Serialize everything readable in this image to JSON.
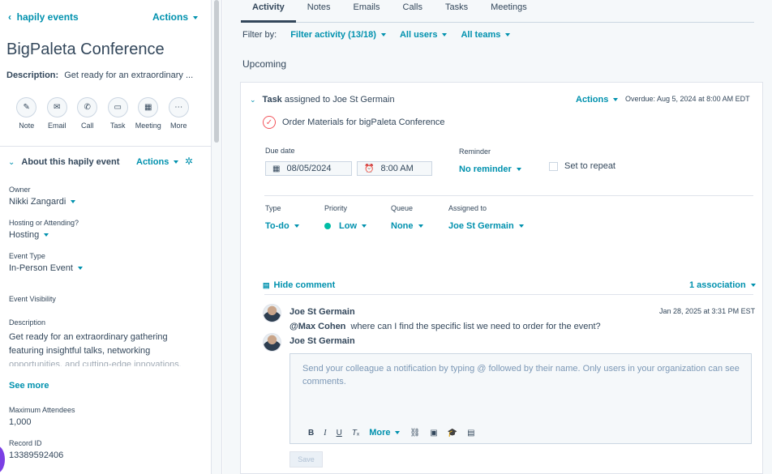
{
  "sidebar": {
    "back_link": "hapily events",
    "actions": "Actions",
    "title": "BigPaleta Conference",
    "description_label": "Description:",
    "description_preview": "Get ready for an extraordinary ...",
    "quick_actions": [
      {
        "label": "Note",
        "icon": "note-icon"
      },
      {
        "label": "Email",
        "icon": "email-icon"
      },
      {
        "label": "Call",
        "icon": "call-icon"
      },
      {
        "label": "Task",
        "icon": "task-icon"
      },
      {
        "label": "Meeting",
        "icon": "meeting-icon"
      },
      {
        "label": "More",
        "icon": "more-icon"
      }
    ],
    "about_title": "About this hapily event",
    "about_actions": "Actions",
    "fields": {
      "owner_label": "Owner",
      "owner_value": "Nikki Zangardi",
      "hosting_label": "Hosting or Attending?",
      "hosting_value": "Hosting",
      "event_type_label": "Event Type",
      "event_type_value": "In-Person Event",
      "visibility_label": "Event Visibility",
      "description_label": "Description",
      "description_line1": "Get ready for an extraordinary gathering",
      "description_line2": "featuring insightful talks, networking",
      "description_line3": "opportunities, and cutting-edge innovations.",
      "see_more": "See more",
      "max_attendees_label": "Maximum Attendees",
      "max_attendees_value": "1,000",
      "record_id_label": "Record ID",
      "record_id_value": "13389592406"
    }
  },
  "main": {
    "tabs": [
      "Activity",
      "Notes",
      "Emails",
      "Calls",
      "Tasks",
      "Meetings"
    ],
    "filter_by_label": "Filter by:",
    "filter_activity": "Filter activity (13/18)",
    "all_users": "All users",
    "all_teams": "All teams",
    "upcoming_label": "Upcoming",
    "task": {
      "type_word": "Task",
      "assigned_text": "assigned to Joe St Germain",
      "actions": "Actions",
      "overdue": "Overdue: Aug 5, 2024 at 8:00 AM EDT",
      "title": "Order Materials for bigPaleta Conference",
      "due_date_label": "Due date",
      "due_date_value": "08/05/2024",
      "time_value": "8:00 AM",
      "reminder_label": "Reminder",
      "reminder_value": "No reminder",
      "set_to_repeat": "Set to repeat",
      "type_label": "Type",
      "type_value": "To-do",
      "priority_label": "Priority",
      "priority_value": "Low",
      "queue_label": "Queue",
      "queue_value": "None",
      "assigned_to_label": "Assigned to",
      "assigned_to_value": "Joe St Germain",
      "hide_comment": "Hide comment",
      "association": "1 association"
    },
    "comment": {
      "author": "Joe St Germain",
      "date": "Jan 28, 2025 at 3:31 PM EST",
      "mention": "@Max Cohen",
      "text": "where can I find the specific list we need to order for the event?",
      "reply_author": "Joe St Germain",
      "placeholder": "Send your colleague a notification by typing @ followed by their name. Only users in your organization can see comments.",
      "toolbar_more": "More",
      "save": "Save"
    }
  },
  "colors": {
    "accent": "#0091ae",
    "text": "#33475b",
    "priority_low": "#00bda5",
    "overdue_icon": "#f2545b"
  }
}
